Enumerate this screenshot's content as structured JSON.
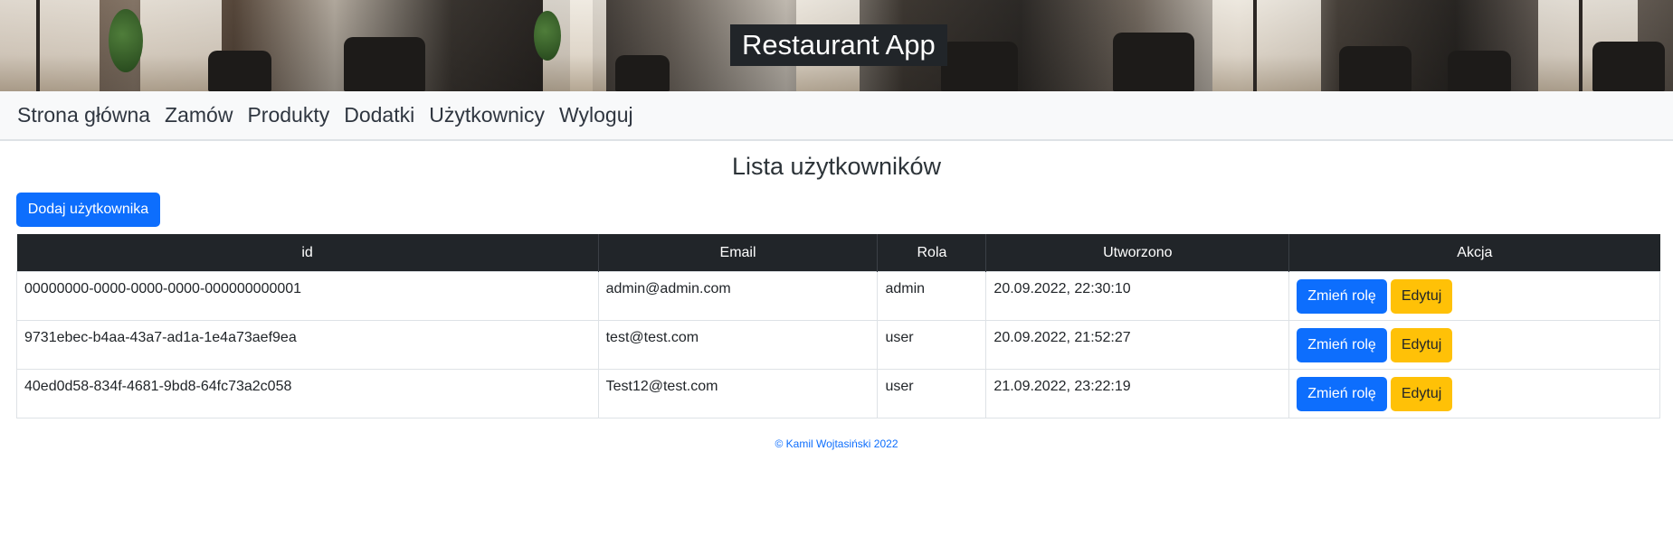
{
  "header": {
    "brand": "Restaurant App"
  },
  "nav": {
    "items": [
      "Strona główna",
      "Zamów",
      "Produkty",
      "Dodatki",
      "Użytkownicy",
      "Wyloguj"
    ]
  },
  "main": {
    "title": "Lista użytkowników",
    "add_button": "Dodaj użytkownika",
    "table": {
      "headers": [
        "id",
        "Email",
        "Rola",
        "Utworzono",
        "Akcja"
      ],
      "rows": [
        {
          "id": "00000000-0000-0000-0000-000000000001",
          "email": "admin@admin.com",
          "role": "admin",
          "created": "20.09.2022, 22:30:10",
          "role_button": "Zmień rolę",
          "edit_button": "Edytuj"
        },
        {
          "id": "9731ebec-b4aa-43a7-ad1a-1e4a73aef9ea",
          "email": "test@test.com",
          "role": "user",
          "created": "20.09.2022, 21:52:27",
          "role_button": "Zmień rolę",
          "edit_button": "Edytuj"
        },
        {
          "id": "40ed0d58-834f-4681-9bd8-64fc73a2c058",
          "email": "Test12@test.com",
          "role": "user",
          "created": "21.09.2022, 23:22:19",
          "role_button": "Zmień rolę",
          "edit_button": "Edytuj"
        }
      ]
    }
  },
  "footer": {
    "text": "© Kamil Wojtasiński 2022"
  },
  "colors": {
    "primary": "#0d6efd",
    "warning": "#ffc107",
    "dark": "#212529",
    "nav_bg": "#f8f9fa"
  }
}
